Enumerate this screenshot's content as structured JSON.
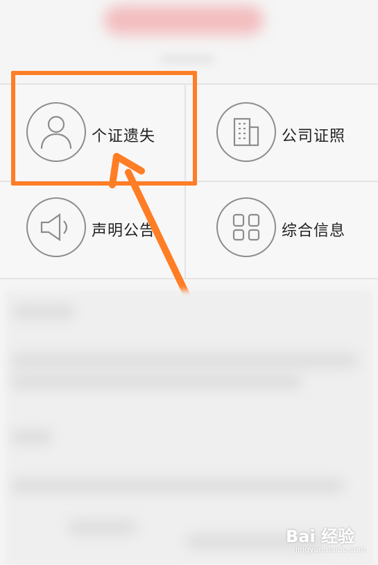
{
  "grid": {
    "items": [
      {
        "label": "个证遗失",
        "icon": "person-icon"
      },
      {
        "label": "公司证照",
        "icon": "building-icon"
      },
      {
        "label": "声明公告",
        "icon": "megaphone-icon"
      },
      {
        "label": "综合信息",
        "icon": "apps-grid-icon"
      }
    ]
  },
  "colors": {
    "highlight": "#ff7d24",
    "icon_stroke": "#8c8c8c"
  },
  "watermark": {
    "text": "Bai 经验",
    "sub": "jingyan.baidu.com"
  }
}
